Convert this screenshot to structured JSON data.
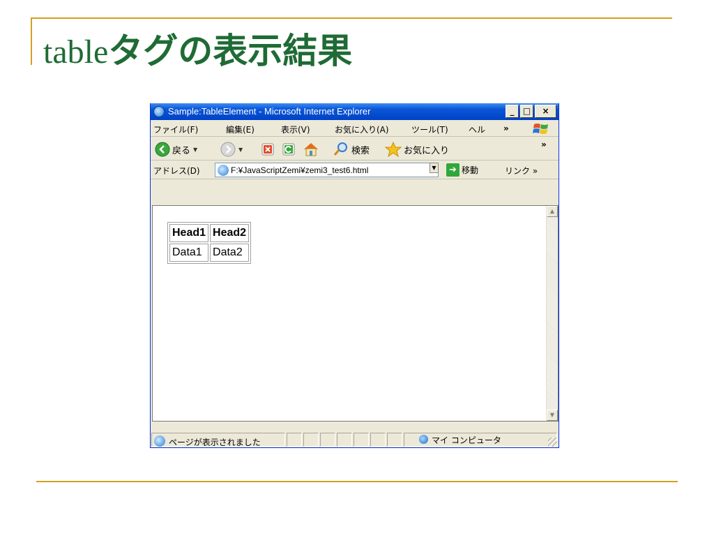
{
  "slide": {
    "title_latin": "table",
    "title_jp": "タグの表示結果"
  },
  "window": {
    "title": "Sample:TableElement - Microsoft Internet Explorer",
    "minimize": "_",
    "maximize": "□",
    "close": "×"
  },
  "menu": [
    "ファイル(F)",
    "編集(E)",
    "表示(V)",
    "お気に入り(A)",
    "ツール(T)",
    "ヘル"
  ],
  "menu_more": "»",
  "toolbar": {
    "back": "戻る",
    "search": "検索",
    "favorites": "お気に入り",
    "more": "»"
  },
  "address": {
    "label": "アドレス(D)",
    "url": "F:¥JavaScriptZemi¥zemi3_test6.html",
    "go": "移動",
    "links": "リンク »"
  },
  "table": {
    "headers": [
      "Head1",
      "Head2"
    ],
    "rows": [
      [
        "Data1",
        "Data2"
      ]
    ]
  },
  "status": {
    "text": "ページが表示されました",
    "zone": "マイ コンピュータ"
  },
  "colors": {
    "title_green": "#1f6b35",
    "rule_gold": "#d4a020",
    "titlebar_blue": "#0a56d8"
  }
}
